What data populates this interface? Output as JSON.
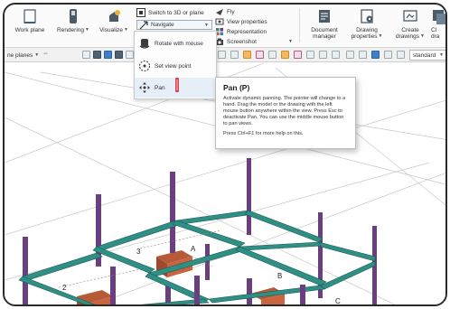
{
  "ribbon": {
    "work_plane": "Work plane",
    "rendering": "Rendering",
    "visualize": "Visualize",
    "switch_3d_plane": "Switch to 3D or plane",
    "navigate": "Navigate",
    "fly": "Fly",
    "view_properties": "View properties",
    "representation": "Representation",
    "screenshot": "Screenshot",
    "document_manager_line1": "Document",
    "document_manager_line2": "manager",
    "drawing_properties_line1": "Drawing",
    "drawing_properties_line2": "properties",
    "create_drawings_line1": "Create",
    "create_drawings_line2": "drawings",
    "clone_partial": "Cl",
    "clone_partial2": "dra"
  },
  "toolbar": {
    "planes_select": "ne planes",
    "standard_select": "standard"
  },
  "navigate_menu": {
    "items": [
      {
        "label": "Rotate with mouse",
        "icon": "rotate-icon"
      },
      {
        "label": "Set view point",
        "icon": "view-point-icon"
      },
      {
        "label": "Pan",
        "icon": "pan-icon"
      }
    ]
  },
  "tooltip": {
    "title": "Pan (P)",
    "body": "Activate dynamic panning. The pointer will change to a hand. Drag the model or the drawing with the left mouse button anywhere within the view. Press Esc to deactivate Pan. You can use the middle mouse button to pan views.",
    "help": "Press Ctrl+F1 for more help on this."
  },
  "model_labels": {
    "grid_3": "3",
    "grid_2": "2",
    "grid_a": "A",
    "grid_b": "B",
    "grid_c": "C"
  },
  "colors": {
    "beam": "#2f8f84",
    "beam_dark": "#1d5c55",
    "column": "#6b3f7f",
    "footing": "#c8653f",
    "grid": "#9a9a9a"
  }
}
